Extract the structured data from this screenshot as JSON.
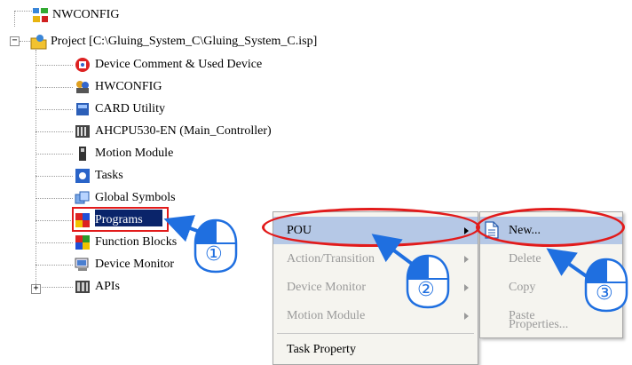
{
  "tree": {
    "root_label": "NWCONFIG",
    "project_label": "Project [C:\\Gluing_System_C\\Gluing_System_C.isp]",
    "items": [
      {
        "label": "Device Comment & Used Device",
        "icon": "device-comment-icon"
      },
      {
        "label": "HWCONFIG",
        "icon": "hwconfig-icon"
      },
      {
        "label": "CARD Utility",
        "icon": "card-utility-icon"
      },
      {
        "label": "AHCPU530-EN  (Main_Controller)",
        "icon": "cpu-module-icon"
      },
      {
        "label": "Motion Module",
        "icon": "motion-module-icon"
      },
      {
        "label": "Tasks",
        "icon": "tasks-icon"
      },
      {
        "label": "Global Symbols",
        "icon": "global-symbols-icon"
      },
      {
        "label": "Programs",
        "icon": "programs-icon"
      },
      {
        "label": "Function Blocks",
        "icon": "function-blocks-icon"
      },
      {
        "label": "Device Monitor",
        "icon": "device-monitor-icon"
      },
      {
        "label": "APIs",
        "icon": "apis-icon"
      }
    ]
  },
  "context_menu": {
    "items": [
      {
        "label": "POU",
        "has_submenu": true,
        "enabled": true,
        "highlighted": true
      },
      {
        "label": "Action/Transition",
        "has_submenu": true,
        "enabled": false
      },
      {
        "label": "Device Monitor",
        "has_submenu": true,
        "enabled": false
      },
      {
        "label": "Motion Module",
        "has_submenu": true,
        "enabled": false
      },
      {
        "label": "Task Property",
        "has_submenu": false,
        "enabled": true
      }
    ]
  },
  "submenu": {
    "items": [
      {
        "label": "New...",
        "enabled": true,
        "highlighted": true,
        "icon": "new-document-icon"
      },
      {
        "label": "Delete",
        "enabled": false
      },
      {
        "label": "Copy",
        "enabled": false
      },
      {
        "label": "Paste",
        "enabled": false
      },
      {
        "label": "Properties...",
        "enabled": false
      }
    ]
  },
  "steps": [
    "①",
    "②",
    "③"
  ],
  "colors": {
    "highlight": "#b5c8e6",
    "selection": "#0a246a",
    "annotation_red": "#e21b1b",
    "arrow_blue": "#1f6fe0"
  }
}
